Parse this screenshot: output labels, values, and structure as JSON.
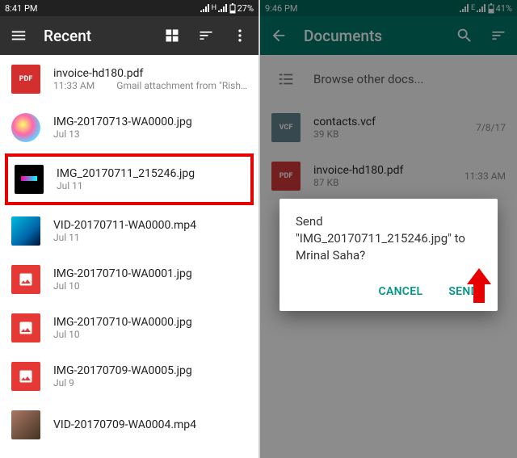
{
  "left": {
    "status": {
      "time": "8:41 PM",
      "net": "H",
      "battery": "27%"
    },
    "title": "Recent",
    "files": [
      {
        "name": "invoice-hd180.pdf",
        "time": "11:33 AM",
        "source": "Gmail attachment from \"Rish…",
        "thumb": "pdf",
        "thumb_label": "PDF"
      },
      {
        "name": "IMG-20170713-WA0000.jpg",
        "time": "Jul 13",
        "thumb": "photo party"
      },
      {
        "name": "IMG_20170711_215246.jpg",
        "time": "Jul 11",
        "thumb": "photo dark solid",
        "highlighted": true
      },
      {
        "name": "VID-20170711-WA0000.mp4",
        "time": "Jul 11",
        "thumb": "photo vid"
      },
      {
        "name": "IMG-20170710-WA0001.jpg",
        "time": "Jul 10",
        "thumb": "img-red"
      },
      {
        "name": "IMG-20170710-WA0000.jpg",
        "time": "Jul 10",
        "thumb": "img-red"
      },
      {
        "name": "IMG-20170709-WA0005.jpg",
        "time": "Jul 9",
        "thumb": "img-red"
      },
      {
        "name": "VID-20170709-WA0004.mp4",
        "time": "",
        "thumb": "photo vid2"
      }
    ]
  },
  "right": {
    "status": {
      "time": "9:46 PM",
      "net": "E",
      "battery": "41%"
    },
    "title": "Documents",
    "browse_label": "Browse other docs...",
    "files": [
      {
        "name": "contacts.vcf",
        "size": "39 KB",
        "date": "7/8/17",
        "thumb": "vcf",
        "thumb_label": "VCF"
      },
      {
        "name": "invoice-hd180.pdf",
        "size": "87 KB",
        "date": "11:33 AM",
        "thumb": "pdf",
        "thumb_label": "PDF"
      }
    ],
    "dialog": {
      "message": "Send \"IMG_20170711_215246.jpg\" to Mrinal Saha?",
      "cancel": "CANCEL",
      "send": "SEND"
    }
  }
}
